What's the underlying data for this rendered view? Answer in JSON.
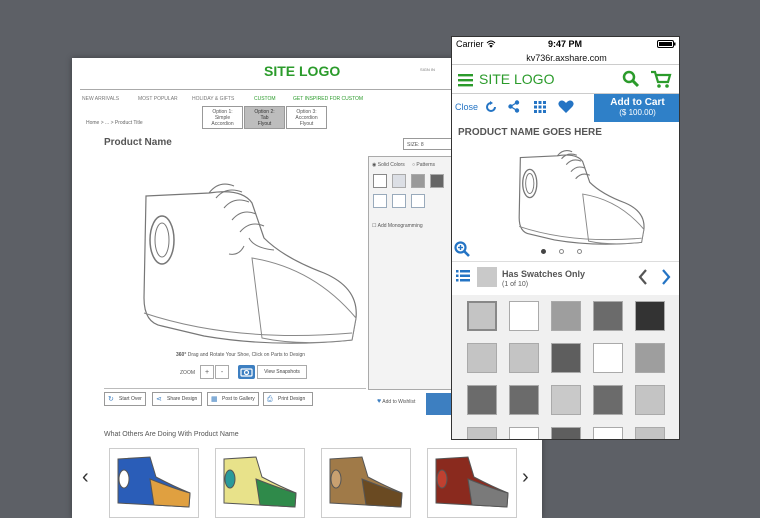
{
  "desktop": {
    "logo": "SITE LOGO",
    "signin": "SIGN IN",
    "nav": [
      "NEW ARRIVALS",
      "MOST POPULAR",
      "HOLIDAY & GIFTS",
      "CUSTOM",
      "GET INSPIRED FOR CUSTOM"
    ],
    "options": [
      {
        "line1": "Option 1:",
        "line2": "Simple",
        "line3": "Accordion"
      },
      {
        "line1": "Option 2:",
        "line2": "Tab",
        "line3": "Flyout"
      },
      {
        "line1": "Option 3:",
        "line2": "Accordion",
        "line3": "Flyout"
      }
    ],
    "breadcrumb": "Home > ... > Product Title",
    "product_name": "Product Name",
    "size": "SIZE: 8",
    "solid_colors": "Solid Colors",
    "patterns": "Patterns",
    "add_monogramming": "Add Monogramming",
    "caption_bold": "360°",
    "caption": " Drag and Rotate Your Shoe, Click on Parts to Design",
    "zoom": "ZOOM",
    "zoom_in": "+",
    "zoom_out": "-",
    "view_snapshots": "View Snapshots",
    "actions": [
      "Start Over",
      "Share Design",
      "Post to Gallery",
      "Print Design"
    ],
    "wishlist": "Add to Wishlist",
    "others": "What Others Are Doing With Product Name",
    "colors": {
      "accent": "#3d7fc1",
      "brand": "#2b9b2b"
    }
  },
  "phone": {
    "carrier": "Carrier",
    "time": "9:47 PM",
    "url": "kv736r.axshare.com",
    "logo": "SITE LOGO",
    "close": "Close",
    "add_to_cart": "Add to Cart",
    "price": "($ 100.00)",
    "product_name": "PRODUCT NAME GOES HERE",
    "has_swatches": "Has Swatches Only",
    "swatch_count": "(1 of 10)",
    "icons": [
      "menu-icon",
      "search-icon",
      "cart-icon",
      "rotate-icon",
      "share-icon",
      "grid-icon",
      "heart-icon",
      "zoom-icon",
      "list-icon"
    ],
    "swatches": [
      "#c4c4c4",
      "#ffffff",
      "#9e9e9e",
      "#6b6b6b",
      "#333333",
      "#c4c4c4",
      "#c4c4c4",
      "#5e5e5e",
      "#ffffff",
      "#9e9e9e",
      "#6b6b6b",
      "#6b6b6b",
      "#c9c9c9",
      "#6b6b6b",
      "#c4c4c4",
      "#c4c4c4",
      "#ffffff",
      "#5e5e5e",
      "#ffffff",
      "#c4c4c4"
    ]
  }
}
